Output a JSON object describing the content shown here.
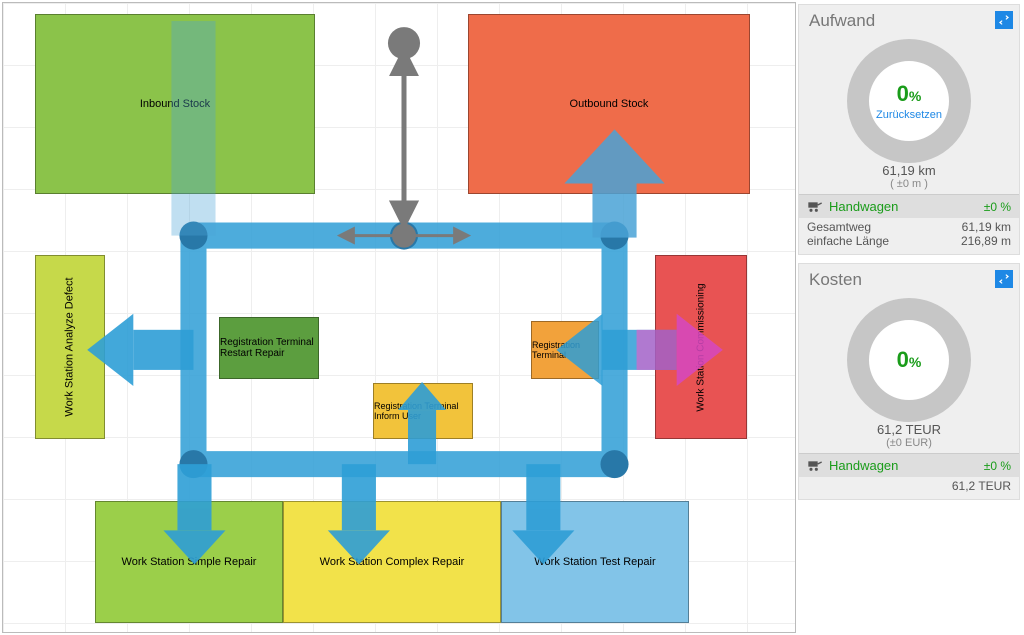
{
  "zones": {
    "inbound": {
      "label": "Inbound Stock"
    },
    "outbound": {
      "label": "Outbound Stock"
    },
    "analyze": {
      "label": "Work Station Analyze Defect"
    },
    "restart": {
      "label": "Registration Terminal Restart Repair"
    },
    "inform": {
      "label": "Registration Terminal Inform User"
    },
    "regterm": {
      "label": "Registration Terminal"
    },
    "commission": {
      "label": "Work Station Commissioning"
    },
    "simple": {
      "label": "Work Station Simple Repair"
    },
    "complex": {
      "label": "Work Station Complex Repair"
    },
    "test": {
      "label": "Work Station Test Repair"
    }
  },
  "panels": {
    "effort": {
      "title": "Aufwand",
      "percent": "0",
      "percent_suffix": "%",
      "reset": "Zurücksetzen",
      "metric": "61,19 km",
      "metric_sub": "( ±0 m )",
      "legend_name": "Handwagen",
      "legend_delta": "±0 %",
      "rows": [
        {
          "k": "Gesamtweg",
          "v": "61,19 km"
        },
        {
          "k": "einfache Länge",
          "v": "216,89 m"
        }
      ]
    },
    "cost": {
      "title": "Kosten",
      "percent": "0",
      "percent_suffix": "%",
      "metric": "61,2 TEUR",
      "metric_sub": "(±0 EUR)",
      "legend_name": "Handwagen",
      "legend_delta": "±0 %",
      "rows": [
        {
          "k": "",
          "v": "61,2 TEUR"
        }
      ]
    }
  },
  "chart_data": [
    {
      "type": "donut",
      "title": "Aufwand",
      "values": [
        0
      ],
      "unit": "%",
      "center_value": 0,
      "total_label": "61,19 km",
      "delta": "±0 m"
    },
    {
      "type": "donut",
      "title": "Kosten",
      "values": [
        0
      ],
      "unit": "%",
      "center_value": 0,
      "total_label": "61,2 TEUR",
      "delta": "±0 EUR"
    }
  ]
}
